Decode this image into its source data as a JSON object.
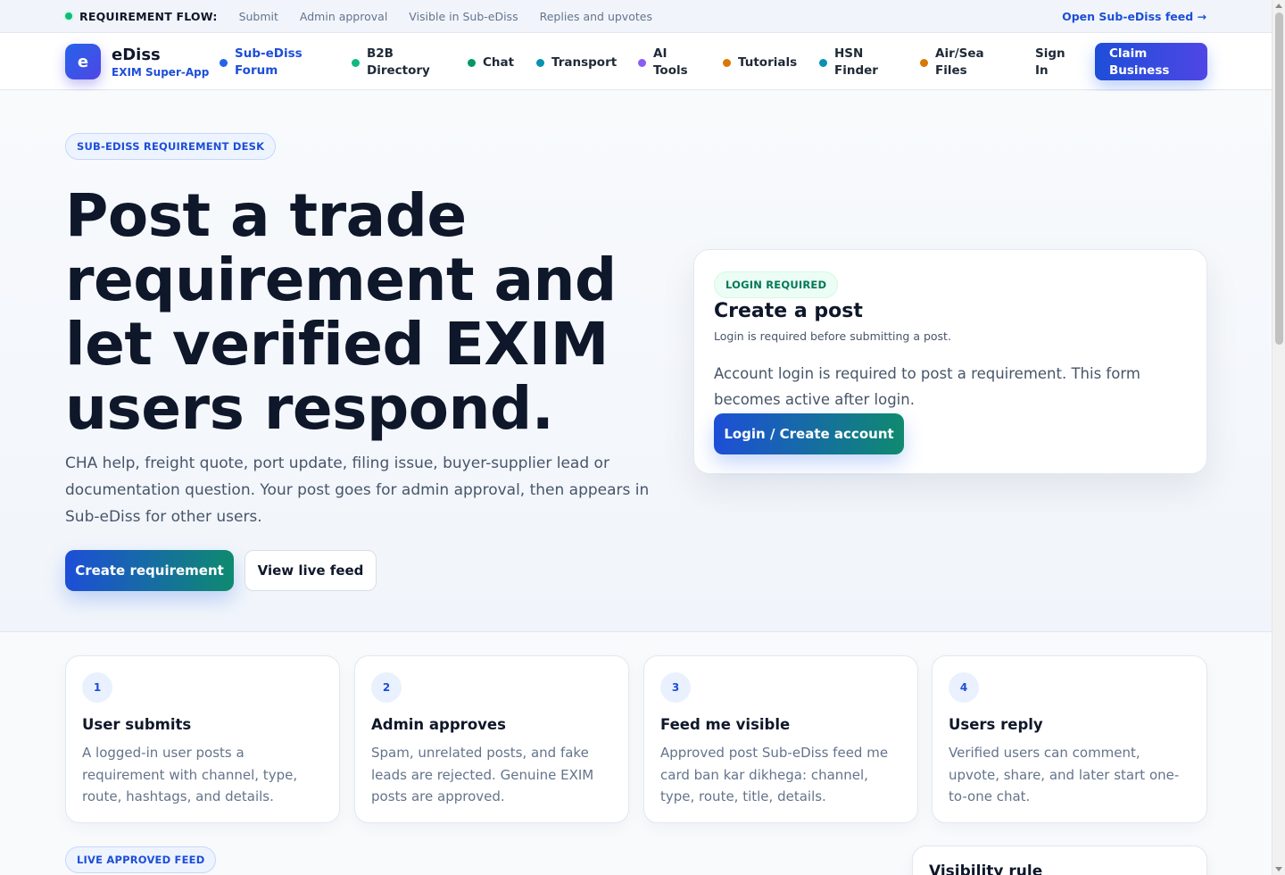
{
  "flowbar": {
    "title": "REQUIREMENT FLOW:",
    "steps": [
      "Submit",
      "Admin approval",
      "Visible in Sub-eDiss",
      "Replies and upvotes"
    ],
    "link": "Open Sub-eDiss feed →"
  },
  "brand": {
    "logo_letter": "e",
    "name": "eDiss",
    "tagline": "EXIM Super-App"
  },
  "nav": {
    "items": [
      {
        "label": "Sub-eDiss Forum",
        "line1": "Sub-eDiss",
        "line2": "Forum",
        "color": "#2563eb",
        "active": true
      },
      {
        "label": "B2B Directory",
        "line1": "B2B",
        "line2": "Directory",
        "color": "#10b981"
      },
      {
        "label": "Chat",
        "line1": "Chat",
        "line2": "",
        "color": "#059669"
      },
      {
        "label": "Transport",
        "line1": "Transport",
        "line2": "",
        "color": "#0891b2"
      },
      {
        "label": "AI Tools",
        "line1": "AI",
        "line2": "Tools",
        "color": "#8b5cf6"
      },
      {
        "label": "Tutorials",
        "line1": "Tutorials",
        "line2": "",
        "color": "#d97706"
      },
      {
        "label": "HSN Finder",
        "line1": "HSN",
        "line2": "Finder",
        "color": "#0891b2"
      },
      {
        "label": "Air/Sea Files",
        "line1": "Air/Sea",
        "line2": "Files",
        "color": "#d97706"
      }
    ],
    "signin_line1": "Sign",
    "signin_line2": "In",
    "claim_line1": "Claim",
    "claim_line2": "Business"
  },
  "hero": {
    "badge": "SUB-EDISS REQUIREMENT DESK",
    "title": "Post a trade requirement and let verified EXIM users respond.",
    "description": "CHA help, freight quote, port update, filing issue, buyer-supplier lead or documentation question. Your post goes for admin approval, then appears in Sub-eDiss for other users.",
    "primary_button": "Create requirement",
    "secondary_button": "View live feed"
  },
  "post_card": {
    "badge": "LOGIN REQUIRED",
    "title": "Create a post",
    "subtitle": "Login is required before submitting a post.",
    "body": "Account login is required to post a requirement. This form becomes active after login.",
    "button": "Login / Create account"
  },
  "steps": [
    {
      "num": "1",
      "title": "User submits",
      "desc": "A logged-in user posts a requirement with channel, type, route, hashtags, and details."
    },
    {
      "num": "2",
      "title": "Admin approves",
      "desc": "Spam, unrelated posts, and fake leads are rejected. Genuine EXIM posts are approved."
    },
    {
      "num": "3",
      "title": "Feed me visible",
      "desc": "Approved post Sub-eDiss feed me card ban kar dikhega: channel, type, route, title, details."
    },
    {
      "num": "4",
      "title": "Users reply",
      "desc": "Verified users can comment, upvote, share, and later start one-to-one chat."
    }
  ],
  "feed": {
    "badge": "LIVE APPROVED FEED",
    "visibility_title": "Visibility rule"
  }
}
